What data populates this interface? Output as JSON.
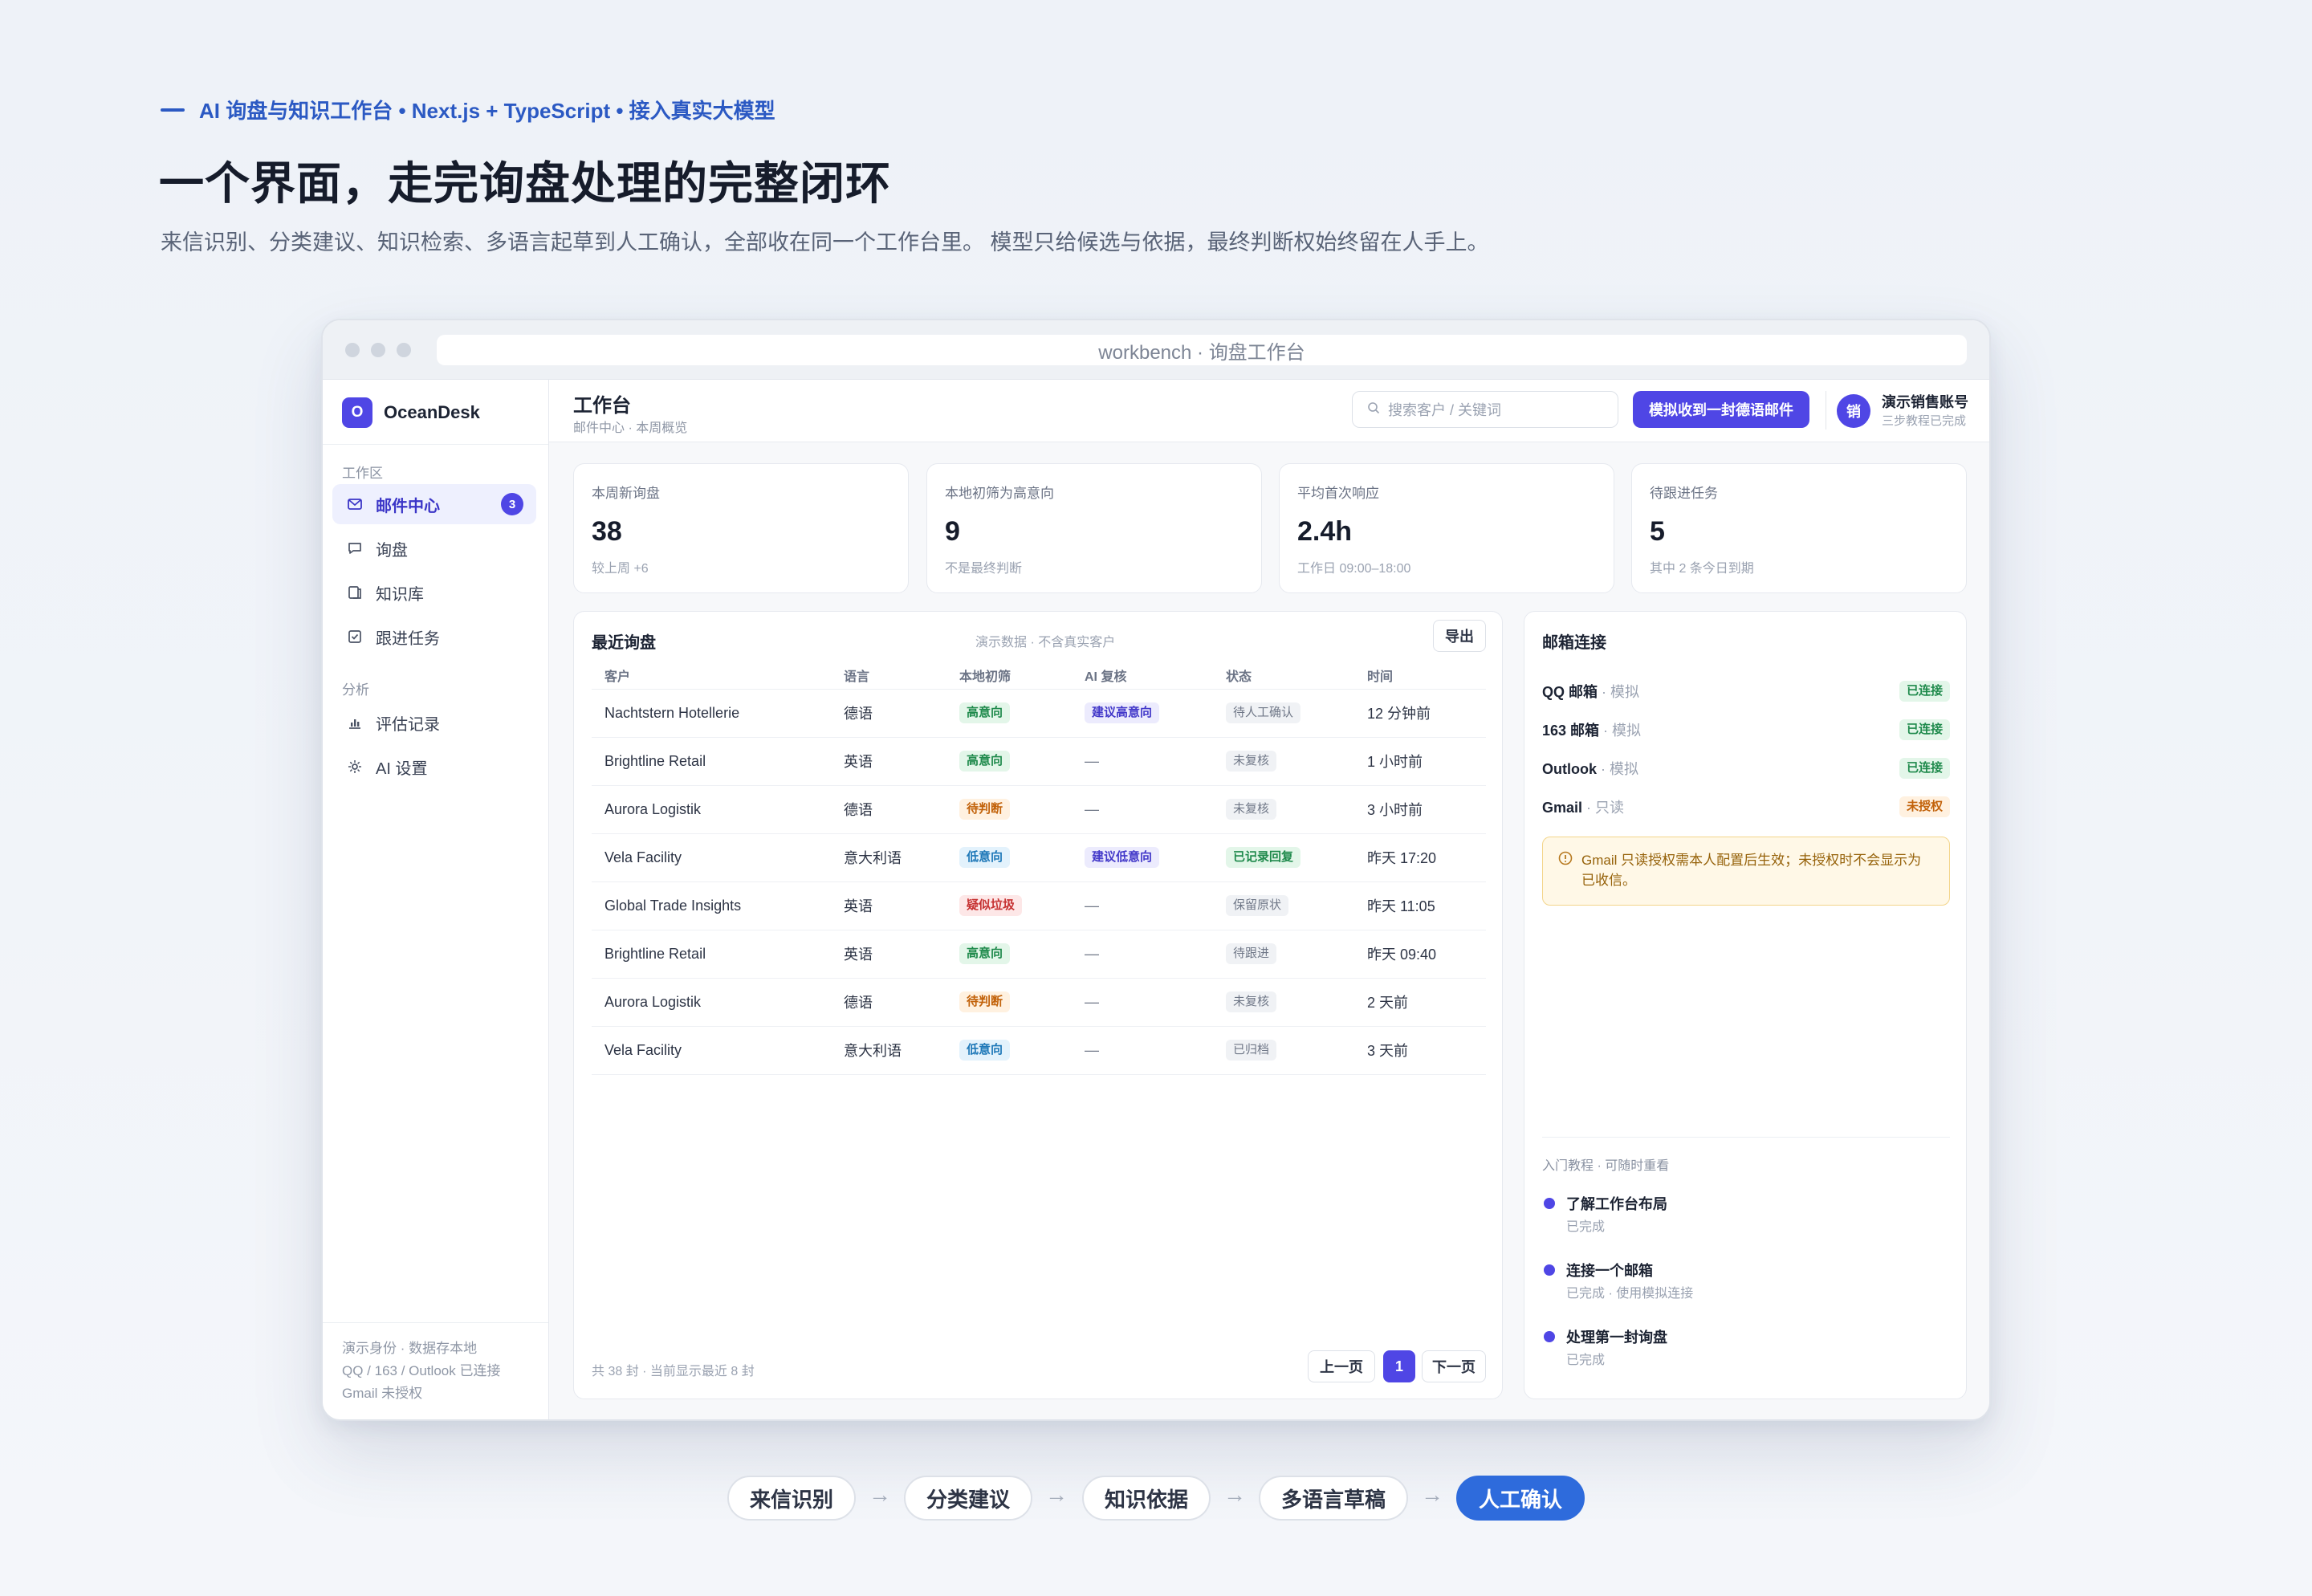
{
  "hero": {
    "eyebrow": "AI 询盘与知识工作台 • Next.js + TypeScript • 接入真实大模型",
    "title": "一个界面，走完询盘处理的完整闭环",
    "subtitle": "来信识别、分类建议、知识检索、多语言起草到人工确认，全部收在同一个工作台里。 模型只给候选与依据，最终判断权始终留在人手上。"
  },
  "window": {
    "url": "workbench · 询盘工作台"
  },
  "sidebar": {
    "brand_logo": "O",
    "brand": "OceanDesk",
    "section_work": "工作区",
    "section_analysis": "分析",
    "items": [
      {
        "label": "邮件中心",
        "icon": "mail-icon",
        "badge": "3",
        "active": true
      },
      {
        "label": "询盘",
        "icon": "chat-icon"
      },
      {
        "label": "知识库",
        "icon": "book-icon"
      },
      {
        "label": "跟进任务",
        "icon": "check-square-icon"
      },
      {
        "label": "评估记录",
        "icon": "bar-chart-icon"
      },
      {
        "label": "AI 设置",
        "icon": "sparkle-icon"
      }
    ],
    "footer": [
      "演示身份 · 数据存本地",
      "QQ / 163 / Outlook 已连接",
      "Gmail 未授权"
    ]
  },
  "topbar": {
    "title": "工作台",
    "breadcrumb": "邮件中心 · 本周概览",
    "search_placeholder": "搜索客户 / 关键词",
    "cta": "模拟收到一封德语邮件",
    "avatar": "销",
    "user_name": "演示销售账号",
    "user_sub": "三步教程已完成"
  },
  "kpis": [
    {
      "label": "本周新询盘",
      "value": "38",
      "note": "较上周 +6"
    },
    {
      "label": "本地初筛为高意向",
      "value": "9",
      "note": "不是最终判断"
    },
    {
      "label": "平均首次响应",
      "value": "2.4h",
      "note": "工作日 09:00–18:00"
    },
    {
      "label": "待跟进任务",
      "value": "5",
      "note": "其中 2 条今日到期"
    }
  ],
  "recent": {
    "title": "最近询盘",
    "note": "演示数据 · 不含真实客户",
    "export": "导出",
    "columns": [
      "客户",
      "语言",
      "本地初筛",
      "AI 复核",
      "状态",
      "时间"
    ],
    "rows": [
      {
        "customer": "Nachtstern Hotellerie",
        "lang": "德语",
        "prelim": "高意向",
        "prelim_color": "green",
        "ai": "建议高意向",
        "ai_color": "purple",
        "status": "待人工确认",
        "status_color": "gray",
        "time": "12 分钟前"
      },
      {
        "customer": "Brightline Retail",
        "lang": "英语",
        "prelim": "高意向",
        "prelim_color": "green",
        "ai": "—",
        "ai_color": "",
        "status": "未复核",
        "status_color": "gray",
        "time": "1 小时前"
      },
      {
        "customer": "Aurora Logistik",
        "lang": "德语",
        "prelim": "待判断",
        "prelim_color": "orange",
        "ai": "—",
        "ai_color": "",
        "status": "未复核",
        "status_color": "gray",
        "time": "3 小时前"
      },
      {
        "customer": "Vela Facility",
        "lang": "意大利语",
        "prelim": "低意向",
        "prelim_color": "blue",
        "ai": "建议低意向",
        "ai_color": "purple",
        "status": "已记录回复",
        "status_color": "green",
        "time": "昨天 17:20"
      },
      {
        "customer": "Global Trade Insights",
        "lang": "英语",
        "prelim": "疑似垃圾",
        "prelim_color": "red",
        "ai": "—",
        "ai_color": "",
        "status": "保留原状",
        "status_color": "gray",
        "time": "昨天 11:05"
      },
      {
        "customer": "Brightline Retail",
        "lang": "英语",
        "prelim": "高意向",
        "prelim_color": "green",
        "ai": "—",
        "ai_color": "",
        "status": "待跟进",
        "status_color": "gray",
        "time": "昨天 09:40"
      },
      {
        "customer": "Aurora Logistik",
        "lang": "德语",
        "prelim": "待判断",
        "prelim_color": "orange",
        "ai": "—",
        "ai_color": "",
        "status": "未复核",
        "status_color": "gray",
        "time": "2 天前"
      },
      {
        "customer": "Vela Facility",
        "lang": "意大利语",
        "prelim": "低意向",
        "prelim_color": "blue",
        "ai": "—",
        "ai_color": "",
        "status": "已归档",
        "status_color": "gray",
        "time": "3 天前"
      }
    ],
    "pager_info": "共 38 封 · 当前显示最近 8 封",
    "prev": "上一页",
    "page": "1",
    "next": "下一页"
  },
  "mail": {
    "title": "邮箱连接",
    "accounts": [
      {
        "name": "QQ 邮箱",
        "mode": " · 模拟",
        "status": "已连接",
        "status_color": "green"
      },
      {
        "name": "163 邮箱",
        "mode": " · 模拟",
        "status": "已连接",
        "status_color": "green"
      },
      {
        "name": "Outlook",
        "mode": " · 模拟",
        "status": "已连接",
        "status_color": "green"
      },
      {
        "name": "Gmail",
        "mode": " · 只读",
        "status": "未授权",
        "status_color": "orange"
      }
    ],
    "alert": "Gmail 只读授权需本人配置后生效；未授权时不会显示为已收信。",
    "tutorial_head": "入门教程 · 可随时重看",
    "steps": [
      {
        "title": "了解工作台布局",
        "sub": "已完成"
      },
      {
        "title": "连接一个邮箱",
        "sub": "已完成 · 使用模拟连接"
      },
      {
        "title": "处理第一封询盘",
        "sub": "已完成"
      }
    ]
  },
  "flow": [
    "来信识别",
    "分类建议",
    "知识依据",
    "多语言草稿",
    "人工确认"
  ],
  "colors": {
    "accent": "#4f46e5",
    "hero_blue": "#2b59c3",
    "flow_active": "#2e6bdc"
  }
}
